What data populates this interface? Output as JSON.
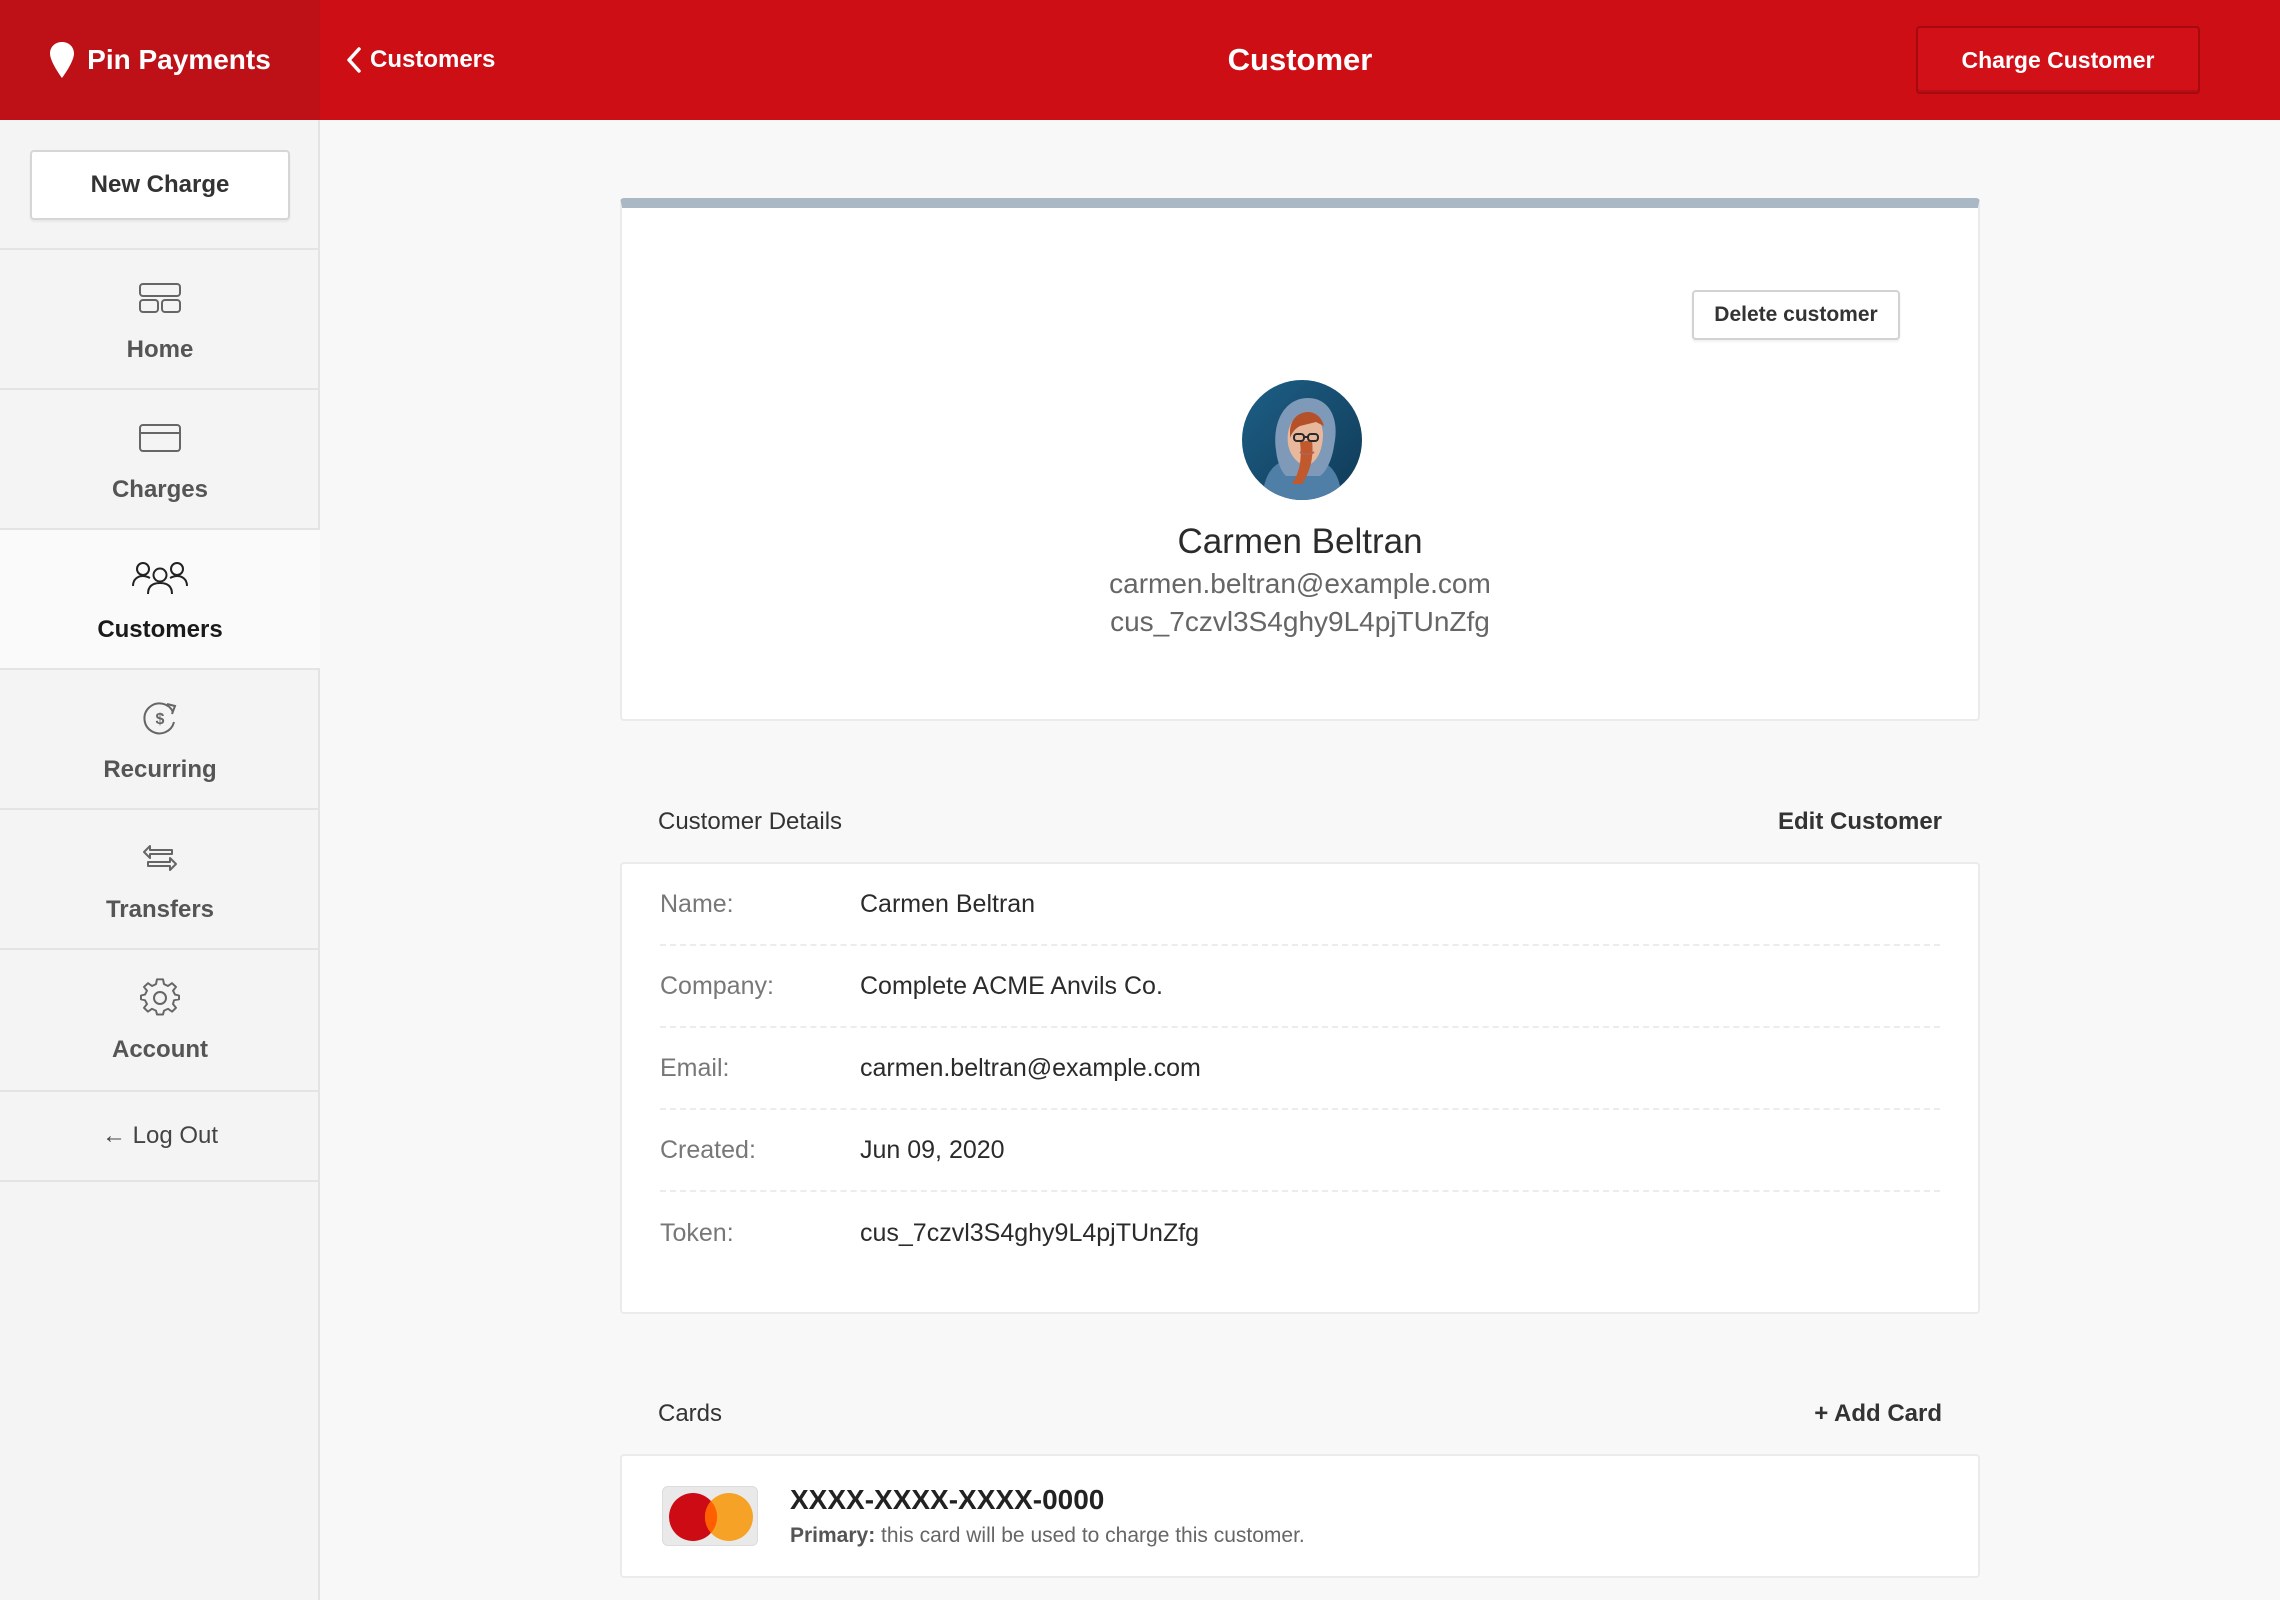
{
  "header": {
    "brand": "Pin Payments",
    "back_label": "Customers",
    "title": "Customer",
    "charge_button": "Charge Customer"
  },
  "sidebar": {
    "new_charge": "New Charge",
    "items": [
      {
        "label": "Home",
        "icon": "home-icon"
      },
      {
        "label": "Charges",
        "icon": "card-icon"
      },
      {
        "label": "Customers",
        "icon": "users-icon",
        "active": true
      },
      {
        "label": "Recurring",
        "icon": "recurring-dollar-icon"
      },
      {
        "label": "Transfers",
        "icon": "transfer-arrows-icon"
      },
      {
        "label": "Account",
        "icon": "gear-icon"
      }
    ],
    "logout": "← Log Out"
  },
  "profile": {
    "delete_button": "Delete customer",
    "name": "Carmen Beltran",
    "email": "carmen.beltran@example.com",
    "token": "cus_7czvl3S4ghy9L4pjTUnZfg"
  },
  "details": {
    "title": "Customer Details",
    "edit_label": "Edit Customer",
    "rows": [
      {
        "key": "Name:",
        "value": "Carmen Beltran"
      },
      {
        "key": "Company:",
        "value": "Complete ACME Anvils Co."
      },
      {
        "key": "Email:",
        "value": "carmen.beltran@example.com"
      },
      {
        "key": "Created:",
        "value": "Jun 09, 2020"
      },
      {
        "key": "Token:",
        "value": "cus_7czvl3S4ghy9L4pjTUnZfg"
      }
    ]
  },
  "cards": {
    "title": "Cards",
    "add_label": "+ Add Card",
    "items": [
      {
        "number": "XXXX-XXXX-XXXX-0000",
        "primary_label": "Primary:",
        "note": " this card will be used to charge this customer.",
        "brand_icon": "mastercard-icon"
      }
    ]
  },
  "colors": {
    "brand_red": "#cd0e14",
    "brand_red_dark": "#be1017",
    "profile_accent": "#a9b8c4"
  }
}
